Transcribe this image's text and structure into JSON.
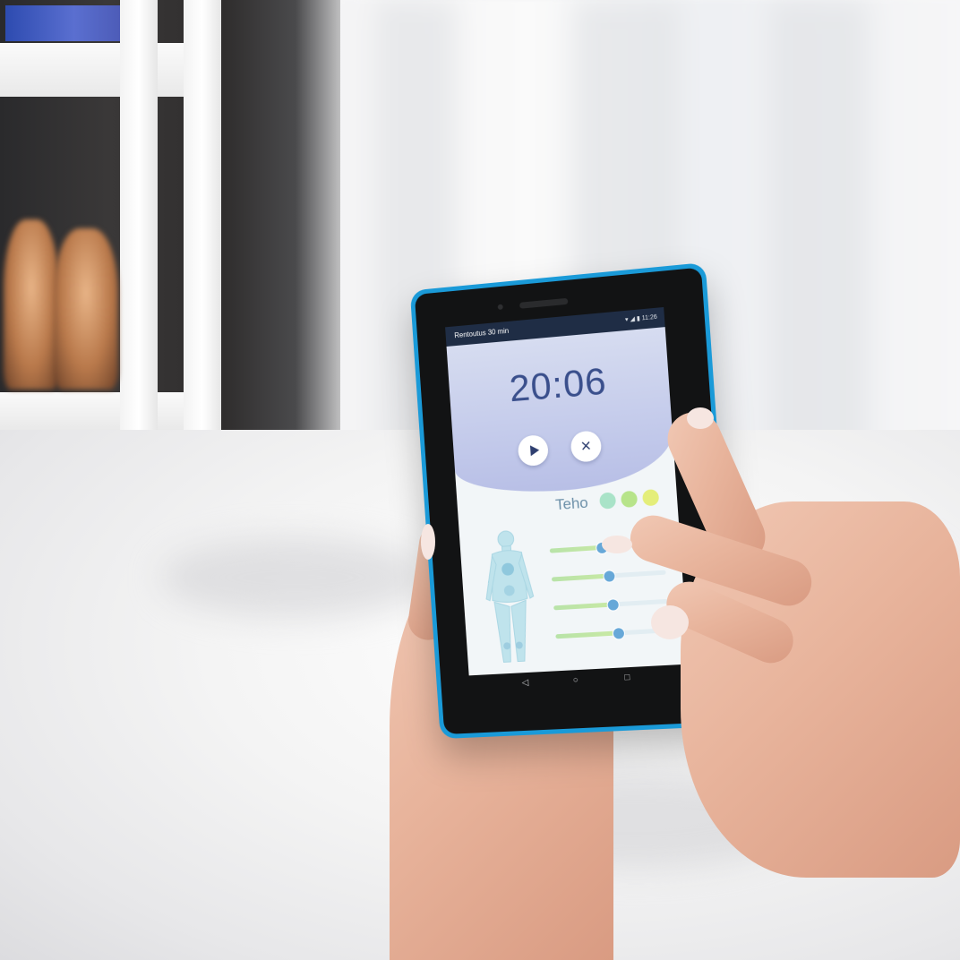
{
  "tablet": {
    "status_bar": {
      "app_title": "Rentoutus 30 min",
      "status_icons": "▾ ◢ ▮ 11:26"
    },
    "timer": "20:06",
    "controls": {
      "play_icon": "play-icon",
      "close_icon": "close-icon",
      "close_glyph": "×"
    },
    "power": {
      "label": "Teho",
      "levels": [
        {
          "name": "L",
          "color": "#a9e3c8"
        },
        {
          "name": "M",
          "color": "#b7e48a"
        },
        {
          "name": "H",
          "color": "#e4ee7a"
        }
      ]
    },
    "sliders": [
      {
        "level": 0.45
      },
      {
        "level": 0.5
      },
      {
        "level": 0.52
      },
      {
        "level": 0.55
      }
    ],
    "nav": {
      "back": "◁",
      "home": "○",
      "recents": "□"
    }
  },
  "colors": {
    "tablet_frame": "#1a9ad8",
    "timer_text": "#3a4f8c",
    "slider_knob": "#67a8d8"
  }
}
